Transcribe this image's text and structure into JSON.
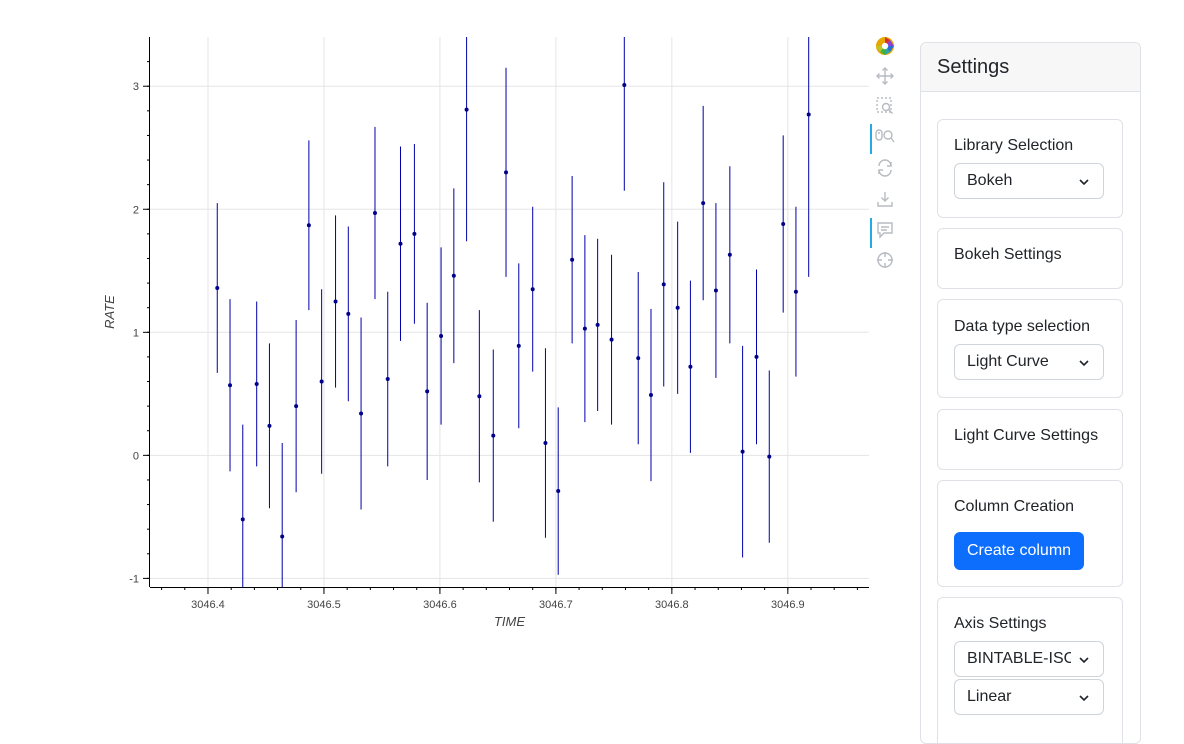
{
  "colors": {
    "series": "#00008b",
    "errorbar": "#0000aa",
    "accent": "#0d6efd",
    "toolbar_active": "#26aae1"
  },
  "toolbar": {
    "tools": [
      {
        "name": "bokeh-logo-icon",
        "active": false
      },
      {
        "name": "pan-icon",
        "active": false
      },
      {
        "name": "box-zoom-icon",
        "active": false
      },
      {
        "name": "wheel-zoom-icon",
        "active": true
      },
      {
        "name": "reset-icon",
        "active": false
      },
      {
        "name": "save-icon",
        "active": false
      },
      {
        "name": "hover-icon",
        "active": true
      },
      {
        "name": "crosshair-icon",
        "active": false
      }
    ]
  },
  "settings": {
    "title": "Settings",
    "library": {
      "title": "Library Selection",
      "value": "Bokeh"
    },
    "bokeh_settings": {
      "title": "Bokeh Settings"
    },
    "data_type": {
      "title": "Data type selection",
      "value": "Light Curve"
    },
    "lc_settings": {
      "title": "Light Curve Settings"
    },
    "column_creation": {
      "title": "Column Creation",
      "button": "Create column"
    },
    "axis_settings": {
      "title": "Axis Settings",
      "column_value": "BINTABLE-ISOCOL",
      "scale_value": "Linear"
    }
  },
  "chart_data": {
    "type": "scatter",
    "xlabel": "TIME",
    "ylabel": "RATE",
    "xlim": [
      3046.35,
      3046.97
    ],
    "ylim": [
      -1.07,
      3.4
    ],
    "xticks": [
      "3046.4",
      "3046.5",
      "3046.6",
      "3046.7",
      "3046.8",
      "3046.9"
    ],
    "yticks": [
      "-1",
      "0",
      "1",
      "2",
      "3"
    ],
    "grid": true,
    "error_bars": true,
    "points": [
      {
        "x": 3046.408,
        "y": 1.36,
        "err": 0.69
      },
      {
        "x": 3046.419,
        "y": 0.57,
        "err": 0.7
      },
      {
        "x": 3046.43,
        "y": -0.52,
        "err": 0.77
      },
      {
        "x": 3046.442,
        "y": 0.58,
        "err": 0.67
      },
      {
        "x": 3046.453,
        "y": 0.24,
        "err": 0.67
      },
      {
        "x": 3046.464,
        "y": -0.66,
        "err": 0.76
      },
      {
        "x": 3046.476,
        "y": 0.4,
        "err": 0.7
      },
      {
        "x": 3046.487,
        "y": 1.87,
        "err": 0.69
      },
      {
        "x": 3046.498,
        "y": 0.6,
        "err": 0.75
      },
      {
        "x": 3046.51,
        "y": 1.25,
        "err": 0.7
      },
      {
        "x": 3046.521,
        "y": 1.15,
        "err": 0.71
      },
      {
        "x": 3046.532,
        "y": 0.34,
        "err": 0.78
      },
      {
        "x": 3046.544,
        "y": 1.97,
        "err": 0.7
      },
      {
        "x": 3046.555,
        "y": 0.62,
        "err": 0.71
      },
      {
        "x": 3046.566,
        "y": 1.72,
        "err": 0.79
      },
      {
        "x": 3046.578,
        "y": 1.8,
        "err": 0.73
      },
      {
        "x": 3046.589,
        "y": 0.52,
        "err": 0.72
      },
      {
        "x": 3046.601,
        "y": 0.97,
        "err": 0.72
      },
      {
        "x": 3046.612,
        "y": 1.46,
        "err": 0.71
      },
      {
        "x": 3046.623,
        "y": 2.81,
        "err": 1.07
      },
      {
        "x": 3046.634,
        "y": 0.48,
        "err": 0.7
      },
      {
        "x": 3046.646,
        "y": 0.16,
        "err": 0.7
      },
      {
        "x": 3046.657,
        "y": 2.3,
        "err": 0.85
      },
      {
        "x": 3046.668,
        "y": 0.89,
        "err": 0.67
      },
      {
        "x": 3046.68,
        "y": 1.35,
        "err": 0.67
      },
      {
        "x": 3046.691,
        "y": 0.1,
        "err": 0.77
      },
      {
        "x": 3046.702,
        "y": -0.29,
        "err": 0.68
      },
      {
        "x": 3046.714,
        "y": 1.59,
        "err": 0.68
      },
      {
        "x": 3046.725,
        "y": 1.03,
        "err": 0.76
      },
      {
        "x": 3046.736,
        "y": 1.06,
        "err": 0.7
      },
      {
        "x": 3046.748,
        "y": 0.94,
        "err": 0.69
      },
      {
        "x": 3046.759,
        "y": 3.01,
        "err": 0.86
      },
      {
        "x": 3046.771,
        "y": 0.79,
        "err": 0.7
      },
      {
        "x": 3046.782,
        "y": 0.49,
        "err": 0.7
      },
      {
        "x": 3046.793,
        "y": 1.39,
        "err": 0.83
      },
      {
        "x": 3046.805,
        "y": 1.2,
        "err": 0.7
      },
      {
        "x": 3046.816,
        "y": 0.72,
        "err": 0.7
      },
      {
        "x": 3046.827,
        "y": 2.05,
        "err": 0.79
      },
      {
        "x": 3046.838,
        "y": 1.34,
        "err": 0.71
      },
      {
        "x": 3046.85,
        "y": 1.63,
        "err": 0.72
      },
      {
        "x": 3046.861,
        "y": 0.03,
        "err": 0.86
      },
      {
        "x": 3046.873,
        "y": 0.8,
        "err": 0.71
      },
      {
        "x": 3046.884,
        "y": -0.01,
        "err": 0.7
      },
      {
        "x": 3046.896,
        "y": 1.88,
        "err": 0.72
      },
      {
        "x": 3046.907,
        "y": 1.33,
        "err": 0.69
      },
      {
        "x": 3046.918,
        "y": 2.77,
        "err": 1.32
      }
    ]
  }
}
